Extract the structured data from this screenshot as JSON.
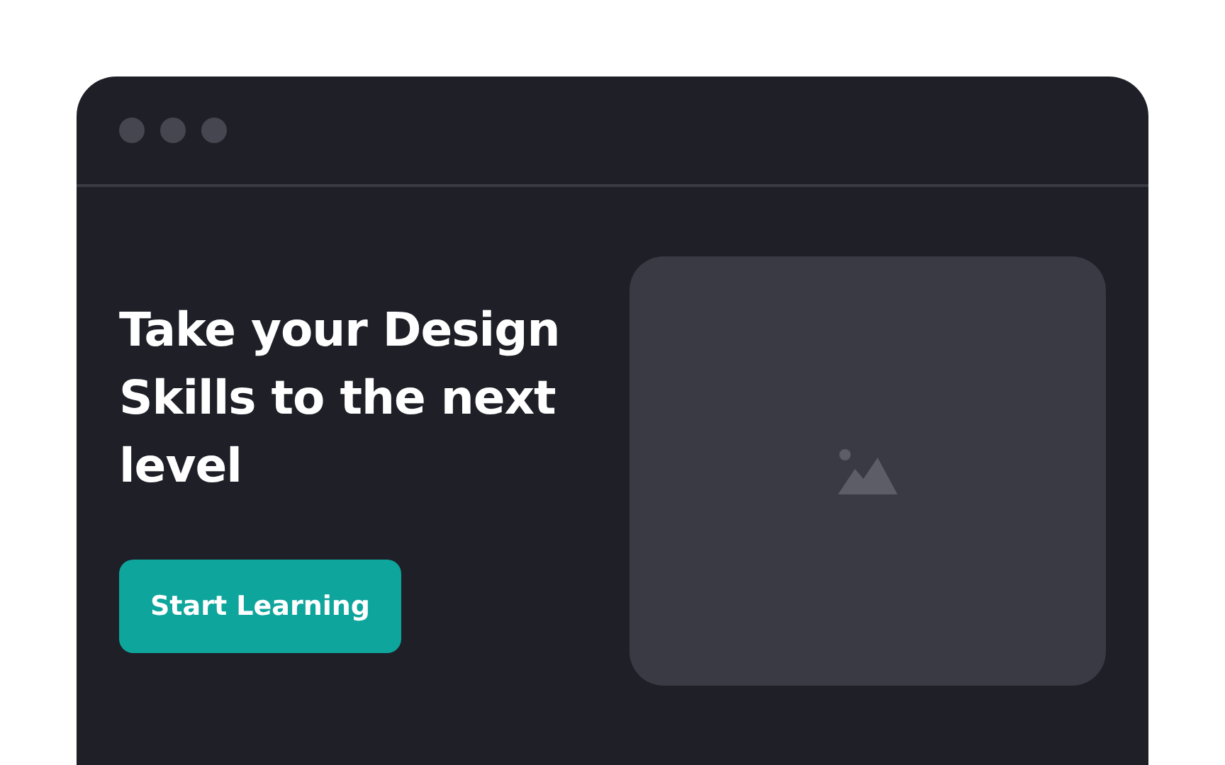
{
  "hero": {
    "heading_lines": [
      "Take your Design",
      "Skills to the next",
      "level"
    ],
    "button": "Start Learning"
  },
  "media": {
    "kind": "image-placeholder"
  }
}
